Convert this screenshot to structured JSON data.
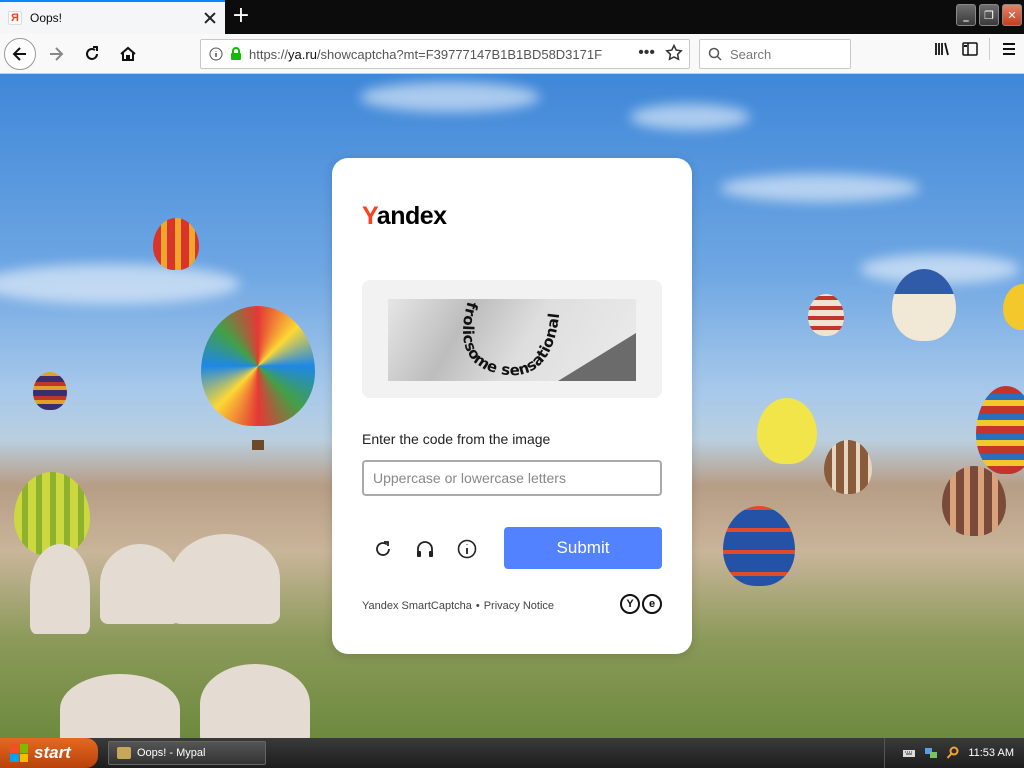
{
  "browser": {
    "tab_title": "Oops!",
    "new_tab_label": "+",
    "url_prefix": "https://",
    "url_host": "ya.ru",
    "url_path": "/showcaptcha?mt=F39777147B1B1BD58D3171F",
    "search_placeholder": "Search"
  },
  "captcha": {
    "logo_first": "Y",
    "logo_rest": "andex",
    "captcha_words": "frolicsome sensational",
    "prompt": "Enter the code from the image",
    "input_placeholder": "Uppercase or lowercase letters",
    "input_value": "",
    "submit_label": "Submit",
    "footer_smartcaptcha": "Yandex SmartCaptcha",
    "footer_separator": "•",
    "footer_privacy": "Privacy Notice",
    "badge_y": "Y",
    "badge_e": "e"
  },
  "taskbar": {
    "start_label": "start",
    "task_label": "Oops! - Mypal",
    "clock": "11:53 AM"
  },
  "colors": {
    "yandex_red": "#fc3f1d",
    "submit_blue": "#5282ff",
    "start_orange": "#e5691f"
  }
}
